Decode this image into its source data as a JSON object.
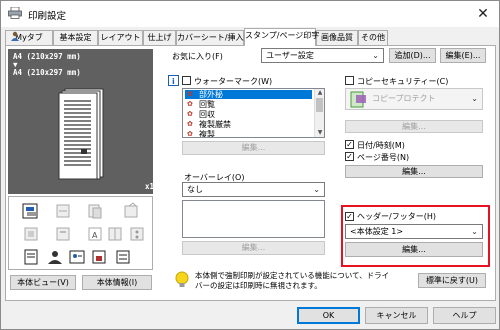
{
  "window": {
    "title": "印刷設定",
    "close_glyph": "✕"
  },
  "tabs": [
    {
      "label": "Myタブ",
      "active": false
    },
    {
      "label": "基本設定",
      "active": false
    },
    {
      "label": "レイアウト",
      "active": false
    },
    {
      "label": "仕上げ",
      "active": false
    },
    {
      "label": "カバーシート/挿入紙",
      "active": false
    },
    {
      "label": "スタンプ/ページ印字",
      "active": true
    },
    {
      "label": "画像品質",
      "active": false
    },
    {
      "label": "その他",
      "active": false
    }
  ],
  "preview": {
    "size_line1": "A4 (210x297 mm)",
    "arrow": "▼",
    "size_line2": "A4 (210x297 mm)",
    "copies": "x1"
  },
  "left_buttons": {
    "printer_view": "本体ビュー(V)",
    "printer_info": "本体情報(I)"
  },
  "favorites": {
    "label": "お気に入り(F)",
    "value": "ユーザー設定",
    "add_button": "追加(D)...",
    "edit_button": "編集(E)..."
  },
  "watermark": {
    "label": "ウォーターマーク(W)",
    "items": [
      "部外秘",
      "回覧",
      "回収",
      "複製厳禁",
      "複製"
    ],
    "edit_button": "編集..."
  },
  "overlay": {
    "label": "オーバーレイ(O)",
    "value": "なし",
    "edit_button": "編集..."
  },
  "copy_security": {
    "label": "コピーセキュリティー(C)",
    "value": "コピープロテクト",
    "edit_button": "編集..."
  },
  "date_time": {
    "label": "日付/時刻(M)",
    "checked": true
  },
  "page_number": {
    "label": "ページ番号(N)",
    "checked": true
  },
  "page_edit_button": "編集...",
  "header_footer": {
    "label": "ヘッダー/フッター(H)",
    "checked": true,
    "value": "<本体設定 1>",
    "edit_button": "編集..."
  },
  "info_text": {
    "line1": "本体側で強制印刷が設定されている機能について、ドライ",
    "line2": "バーの設定は印刷時に無視されます。"
  },
  "restore_button": "標準に戻す(U)",
  "footer_buttons": {
    "ok": "OK",
    "cancel": "キャンセル",
    "help": "ヘルプ"
  },
  "colors": {
    "accent": "#0078d7",
    "highlight_box": "#e81123",
    "selection": "#0078d7"
  }
}
